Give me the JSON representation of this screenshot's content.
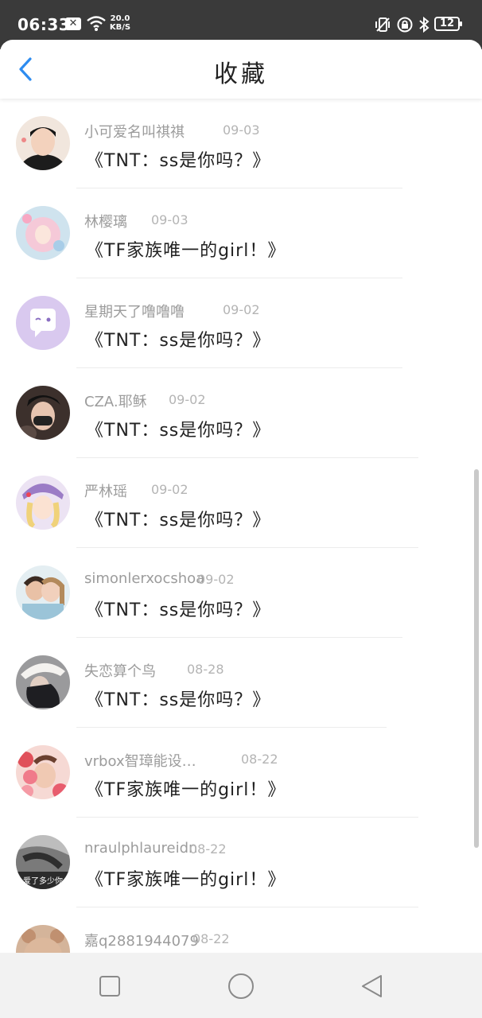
{
  "status_bar": {
    "time": "06:33",
    "network_speed_value": "20.0",
    "network_speed_unit": "KB/S",
    "battery": "12",
    "icons": [
      "xbox-icon",
      "wifi-icon",
      "vibrate-icon",
      "lock-rotation-icon",
      "bluetooth-icon",
      "battery-icon"
    ]
  },
  "header": {
    "title": "收藏",
    "back_icon": "chevron-left-icon",
    "accent_color": "#2d8cf0"
  },
  "favorites": [
    {
      "name": "小可爱名叫祺祺",
      "date": "09-03",
      "title": "《TNT：ss是你吗？》",
      "avatar": "boy-portrait"
    },
    {
      "name": "林樱璃",
      "date": "09-03",
      "title": "《TF家族唯一的girl！》",
      "avatar": "anime-girl-pink"
    },
    {
      "name": "星期天了噜噜噜",
      "date": "09-02",
      "title": "《TNT：ss是你吗？》",
      "avatar": "purple-chat-bubble"
    },
    {
      "name": "CZA.耶稣",
      "date": "09-02",
      "title": "《TNT：ss是你吗？》",
      "avatar": "masked-person"
    },
    {
      "name": "严林瑶",
      "date": "09-02",
      "title": "《TNT：ss是你吗？》",
      "avatar": "anime-girl-blonde"
    },
    {
      "name": "simonlerxocshoa",
      "date": "09-02",
      "title": "《TNT：ss是你吗？》",
      "avatar": "couple-photo"
    },
    {
      "name": "失恋算个鸟",
      "date": "08-28",
      "title": "《TNT：ss是你吗？》",
      "avatar": "girl-hat-dark"
    },
    {
      "name": "vrbox智璋能设…",
      "date": "08-22",
      "title": "《TF家族唯一的girl！》",
      "avatar": "girl-flowers"
    },
    {
      "name": "nraulphlaureidn",
      "date": "08-22",
      "title": "《TF家族唯一的girl！》",
      "avatar": "grayscale-photo",
      "avatar_caption": "爱了多少你"
    },
    {
      "name": "嘉q2881944079",
      "date": "08-22",
      "title": "",
      "avatar": "teddy-bear"
    }
  ],
  "nav_bar": {
    "buttons": [
      "recent-apps-square-icon",
      "home-circle-icon",
      "back-triangle-icon"
    ]
  }
}
